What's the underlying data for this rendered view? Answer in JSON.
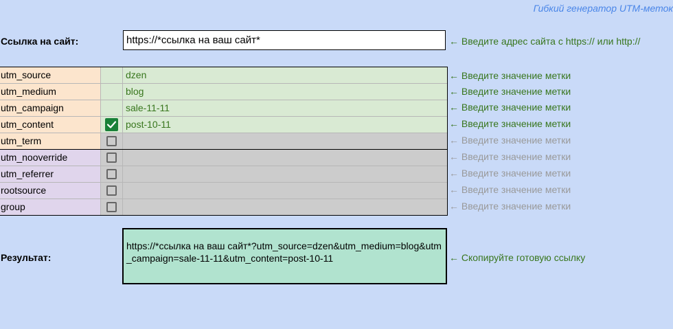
{
  "brand": "Гибкий генератор UTM-меток",
  "site": {
    "label": "Ссылка на сайт:",
    "value": "https://*ссылка на ваш сайт*",
    "hint": "← Введите адрес сайта с https:// или http://"
  },
  "params": [
    {
      "name": "utm_source",
      "checked": true,
      "value": "dzen",
      "hint": "← Введите значение метки"
    },
    {
      "name": "utm_medium",
      "checked": true,
      "value": "blog",
      "hint": "← Введите значение метки"
    },
    {
      "name": "utm_campaign",
      "checked": true,
      "value": "sale-11-11",
      "hint": "← Введите значение метки"
    },
    {
      "name": "utm_content",
      "checked": true,
      "value": "post-10-11",
      "hint": "← Введите значение метки"
    },
    {
      "name": "utm_term",
      "checked": false,
      "value": "",
      "hint": "← Введите значение метки"
    },
    {
      "name": "utm_nooverride",
      "checked": false,
      "value": "",
      "hint": "← Введите значение метки"
    },
    {
      "name": "utm_referrer",
      "checked": false,
      "value": "",
      "hint": "← Введите значение метки"
    },
    {
      "name": "rootsource",
      "checked": false,
      "value": "",
      "hint": "← Введите значение метки"
    },
    {
      "name": "group",
      "checked": false,
      "value": "",
      "hint": "← Введите значение метки"
    }
  ],
  "result": {
    "label": "Результат:",
    "value": "https://*ссылка на ваш сайт*?utm_source=dzen&utm_medium=blog&utm_campaign=sale-11-11&utm_content=post-10-11",
    "hint": "← Скопируйте готовую ссылку"
  },
  "colors": {
    "background": "#c9daf8",
    "hint_green": "#38761d",
    "hint_gray": "#999999",
    "checkbox_on": "#188038",
    "result_bg": "#b1e3cf"
  }
}
